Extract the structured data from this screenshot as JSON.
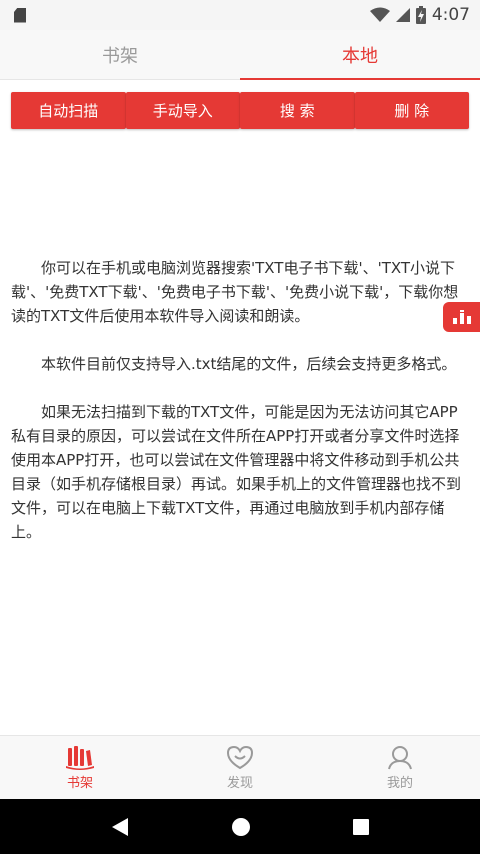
{
  "status_bar": {
    "time": "4:07"
  },
  "tabs": [
    {
      "label": "书架",
      "active": false
    },
    {
      "label": "本地",
      "active": true
    }
  ],
  "buttons": {
    "auto_scan": "自动扫描",
    "manual_import": "手动导入",
    "search": "搜 索",
    "delete": "删 除"
  },
  "content": {
    "paragraph1": "你可以在手机或电脑浏览器搜索'TXT电子书下载'、'TXT小说下载'、'免费TXT下载'、'免费电子书下载'、'免费小说下载'，下载你想读的TXT文件后使用本软件导入阅读和朗读。",
    "paragraph2": "本软件目前仅支持导入.txt结尾的文件，后续会支持更多格式。",
    "paragraph3": "如果无法扫描到下载的TXT文件，可能是因为无法访问其它APP私有目录的原因，可以尝试在文件所在APP打开或者分享文件时选择使用本APP打开，也可以尝试在文件管理器中将文件移动到手机公共目录（如手机存储根目录）再试。如果手机上的文件管理器也找不到文件，可以在电脑上下载TXT文件，再通过电脑放到手机内部存储上。"
  },
  "bottom_nav": [
    {
      "label": "书架",
      "icon": "bookshelf-icon",
      "active": true
    },
    {
      "label": "发现",
      "icon": "discover-icon",
      "active": false
    },
    {
      "label": "我的",
      "icon": "profile-icon",
      "active": false
    }
  ],
  "colors": {
    "accent": "#e53935",
    "inactive": "#9a9a9a"
  }
}
